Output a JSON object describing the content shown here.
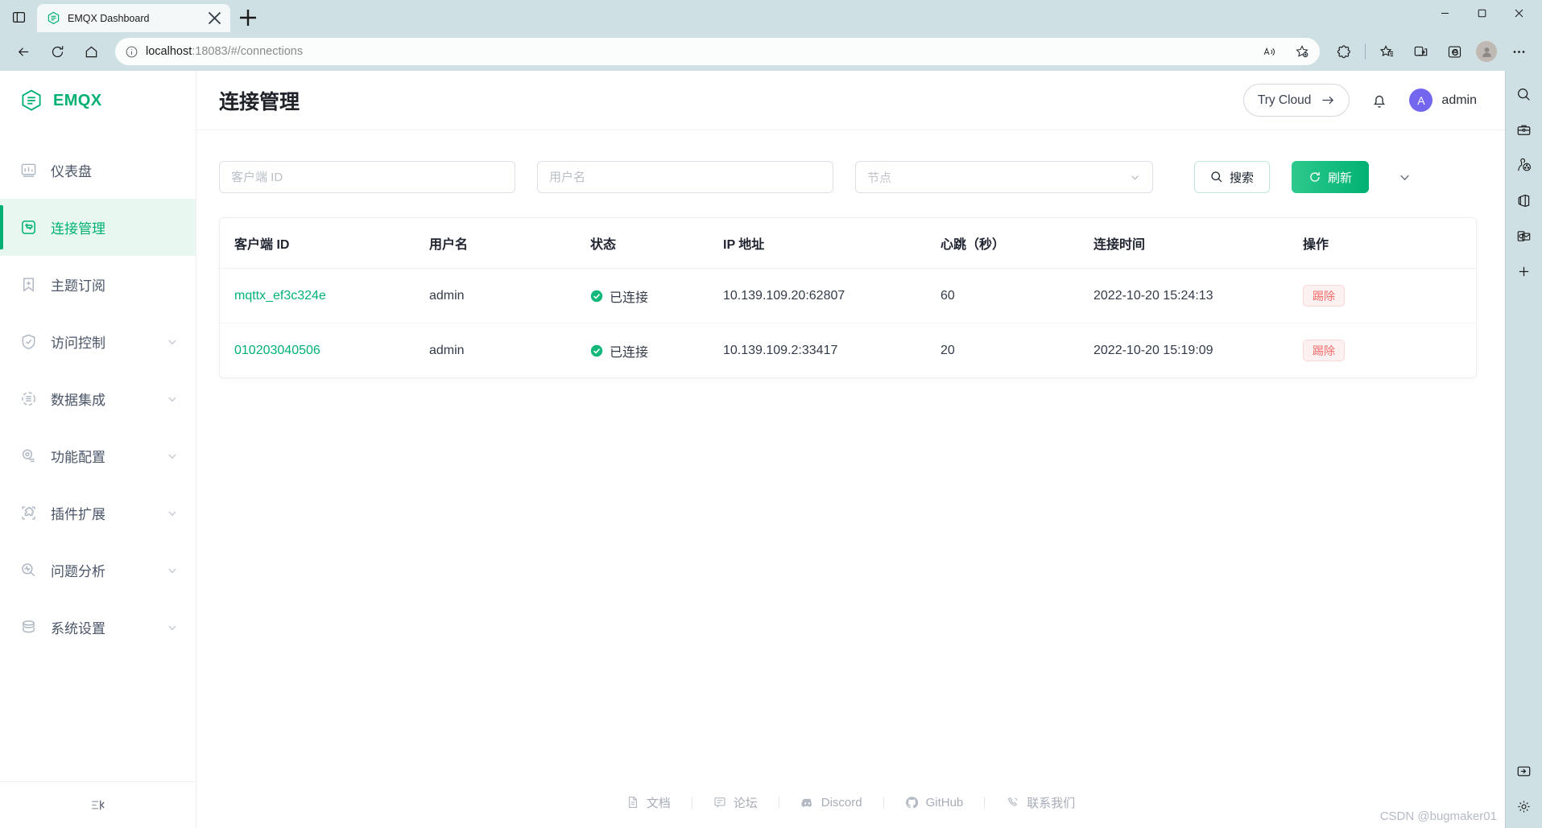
{
  "browser": {
    "tab": {
      "title": "EMQX Dashboard",
      "favicon_icon": "emqx-hex-icon",
      "close_icon": "close-icon"
    },
    "tab_overview_icon": "tab-overview-icon",
    "new_tab_icon": "plus-icon",
    "window_controls": {
      "minimize_icon": "minimize-icon",
      "maximize_icon": "maximize-icon",
      "close_icon": "window-close-icon"
    },
    "nav": {
      "back_icon": "back-arrow-icon",
      "reload_icon": "reload-icon",
      "home_icon": "home-icon"
    },
    "omnibox": {
      "info_icon": "info-circle-icon",
      "url_host": "localhost",
      "url_path": ":18083/#/connections",
      "url_full": "localhost:18083/#/connections",
      "read_aloud_icon": "read-aloud-icon",
      "favorite_icon": "add-favorite-icon"
    },
    "toolbar_icons": [
      "extensions-icon",
      "collections-icon",
      "split-screen-icon",
      "ie-mode-icon",
      "profile-avatar-icon",
      "settings-more-icon"
    ],
    "right_rail_icons": [
      "search-icon",
      "briefcase-icon",
      "games-icon",
      "office-icon",
      "outlook-icon",
      "add-tool-icon",
      "drop-tool-icon",
      "settings-gear-icon"
    ]
  },
  "app": {
    "brand": {
      "name": "EMQX",
      "logo_icon": "emqx-hex-icon",
      "color": "#00b173"
    },
    "sidebar": {
      "items": [
        {
          "label": "仪表盘",
          "icon": "dashboard-icon",
          "active": false,
          "expandable": false
        },
        {
          "label": "连接管理",
          "icon": "connections-icon",
          "active": true,
          "expandable": false
        },
        {
          "label": "主题订阅",
          "icon": "topics-icon",
          "active": false,
          "expandable": false
        },
        {
          "label": "访问控制",
          "icon": "shield-icon",
          "active": false,
          "expandable": true
        },
        {
          "label": "数据集成",
          "icon": "data-integration-icon",
          "active": false,
          "expandable": true
        },
        {
          "label": "功能配置",
          "icon": "gear-config-icon",
          "active": false,
          "expandable": true
        },
        {
          "label": "插件扩展",
          "icon": "puzzle-icon",
          "active": false,
          "expandable": true
        },
        {
          "label": "问题分析",
          "icon": "diagnose-icon",
          "active": false,
          "expandable": true
        },
        {
          "label": "系统设置",
          "icon": "database-icon",
          "active": false,
          "expandable": true
        }
      ],
      "collapse_icon": "collapse-sidebar-icon"
    },
    "header": {
      "title": "连接管理",
      "try_cloud_label": "Try Cloud",
      "try_cloud_arrow": "arrow-right-icon",
      "bell_icon": "bell-icon",
      "user": {
        "initial": "A",
        "name": "admin",
        "avatar_color": "#7467ef"
      }
    },
    "filters": {
      "clientid_placeholder": "客户端 ID",
      "clientid_value": "",
      "username_placeholder": "用户名",
      "username_value": "",
      "node_placeholder": "节点",
      "node_value": "",
      "node_caret_icon": "chevron-down-icon",
      "search_label": "搜索",
      "search_icon": "search-icon",
      "refresh_label": "刷新",
      "refresh_icon": "refresh-icon",
      "more_icon": "chevron-down-icon"
    },
    "table": {
      "columns": [
        "客户端 ID",
        "用户名",
        "状态",
        "IP 地址",
        "心跳（秒）",
        "连接时间",
        "操作"
      ],
      "rows": [
        {
          "clientid": "mqttx_ef3c324e",
          "username": "admin",
          "status": "已连接",
          "status_icon": "check-circle-icon",
          "ip": "10.139.109.20:62807",
          "keepalive": "60",
          "connected_at": "2022-10-20 15:24:13",
          "action": "踢除"
        },
        {
          "clientid": "010203040506",
          "username": "admin",
          "status": "已连接",
          "status_icon": "check-circle-icon",
          "ip": "10.139.109.2:33417",
          "keepalive": "20",
          "connected_at": "2022-10-20 15:19:09",
          "action": "踢除"
        }
      ]
    },
    "footer": {
      "links": [
        {
          "label": "文档",
          "icon": "document-icon"
        },
        {
          "label": "论坛",
          "icon": "forum-icon"
        },
        {
          "label": "Discord",
          "icon": "discord-icon"
        },
        {
          "label": "GitHub",
          "icon": "github-icon"
        },
        {
          "label": "联系我们",
          "icon": "contact-icon"
        }
      ]
    },
    "watermark": "CSDN @bugmaker01"
  }
}
